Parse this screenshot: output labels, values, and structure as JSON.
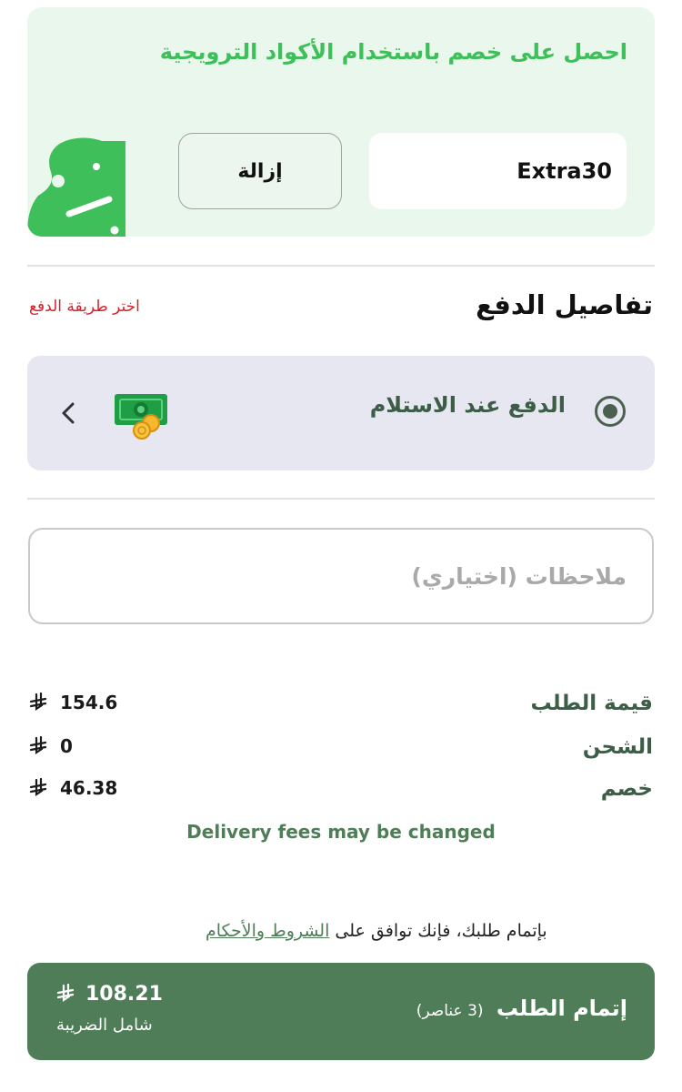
{
  "promo": {
    "title": "احصل على خصم باستخدام الأكواد الترويجية",
    "code_value": "Extra30",
    "remove_label": "إزالة"
  },
  "payment": {
    "section_title": "تفاصيل الدفع",
    "choose_method_label": "اختر طريقة الدفع",
    "selected_method": "الدفع عند الاستلام",
    "icon": "cash-money-icon"
  },
  "notes": {
    "placeholder": "ملاحظات (اختياري)",
    "value": ""
  },
  "summary": {
    "currency_icon": "riyal-icon",
    "rows": [
      {
        "label": "قيمة الطلب",
        "value": "154.6"
      },
      {
        "label": "الشحن",
        "value": "0"
      },
      {
        "label": "خصم",
        "value": "46.38"
      }
    ],
    "delivery_note": "Delivery fees may be changed"
  },
  "terms": {
    "prefix": "بإتمام طلبك، فإنك توافق على ",
    "link": "الشروط والأحكام"
  },
  "checkout": {
    "label": "إتمام الطلب",
    "count_label": "(3 عناصر)",
    "total": "108.21",
    "tax_note": "شامل الضريبة"
  },
  "colors": {
    "primary_green": "#4e7d58",
    "promo_green": "#3fbf5a",
    "promo_bg": "#e9f7ec",
    "alert_red": "#d0242c",
    "payment_card_bg": "#e6e7f1"
  }
}
